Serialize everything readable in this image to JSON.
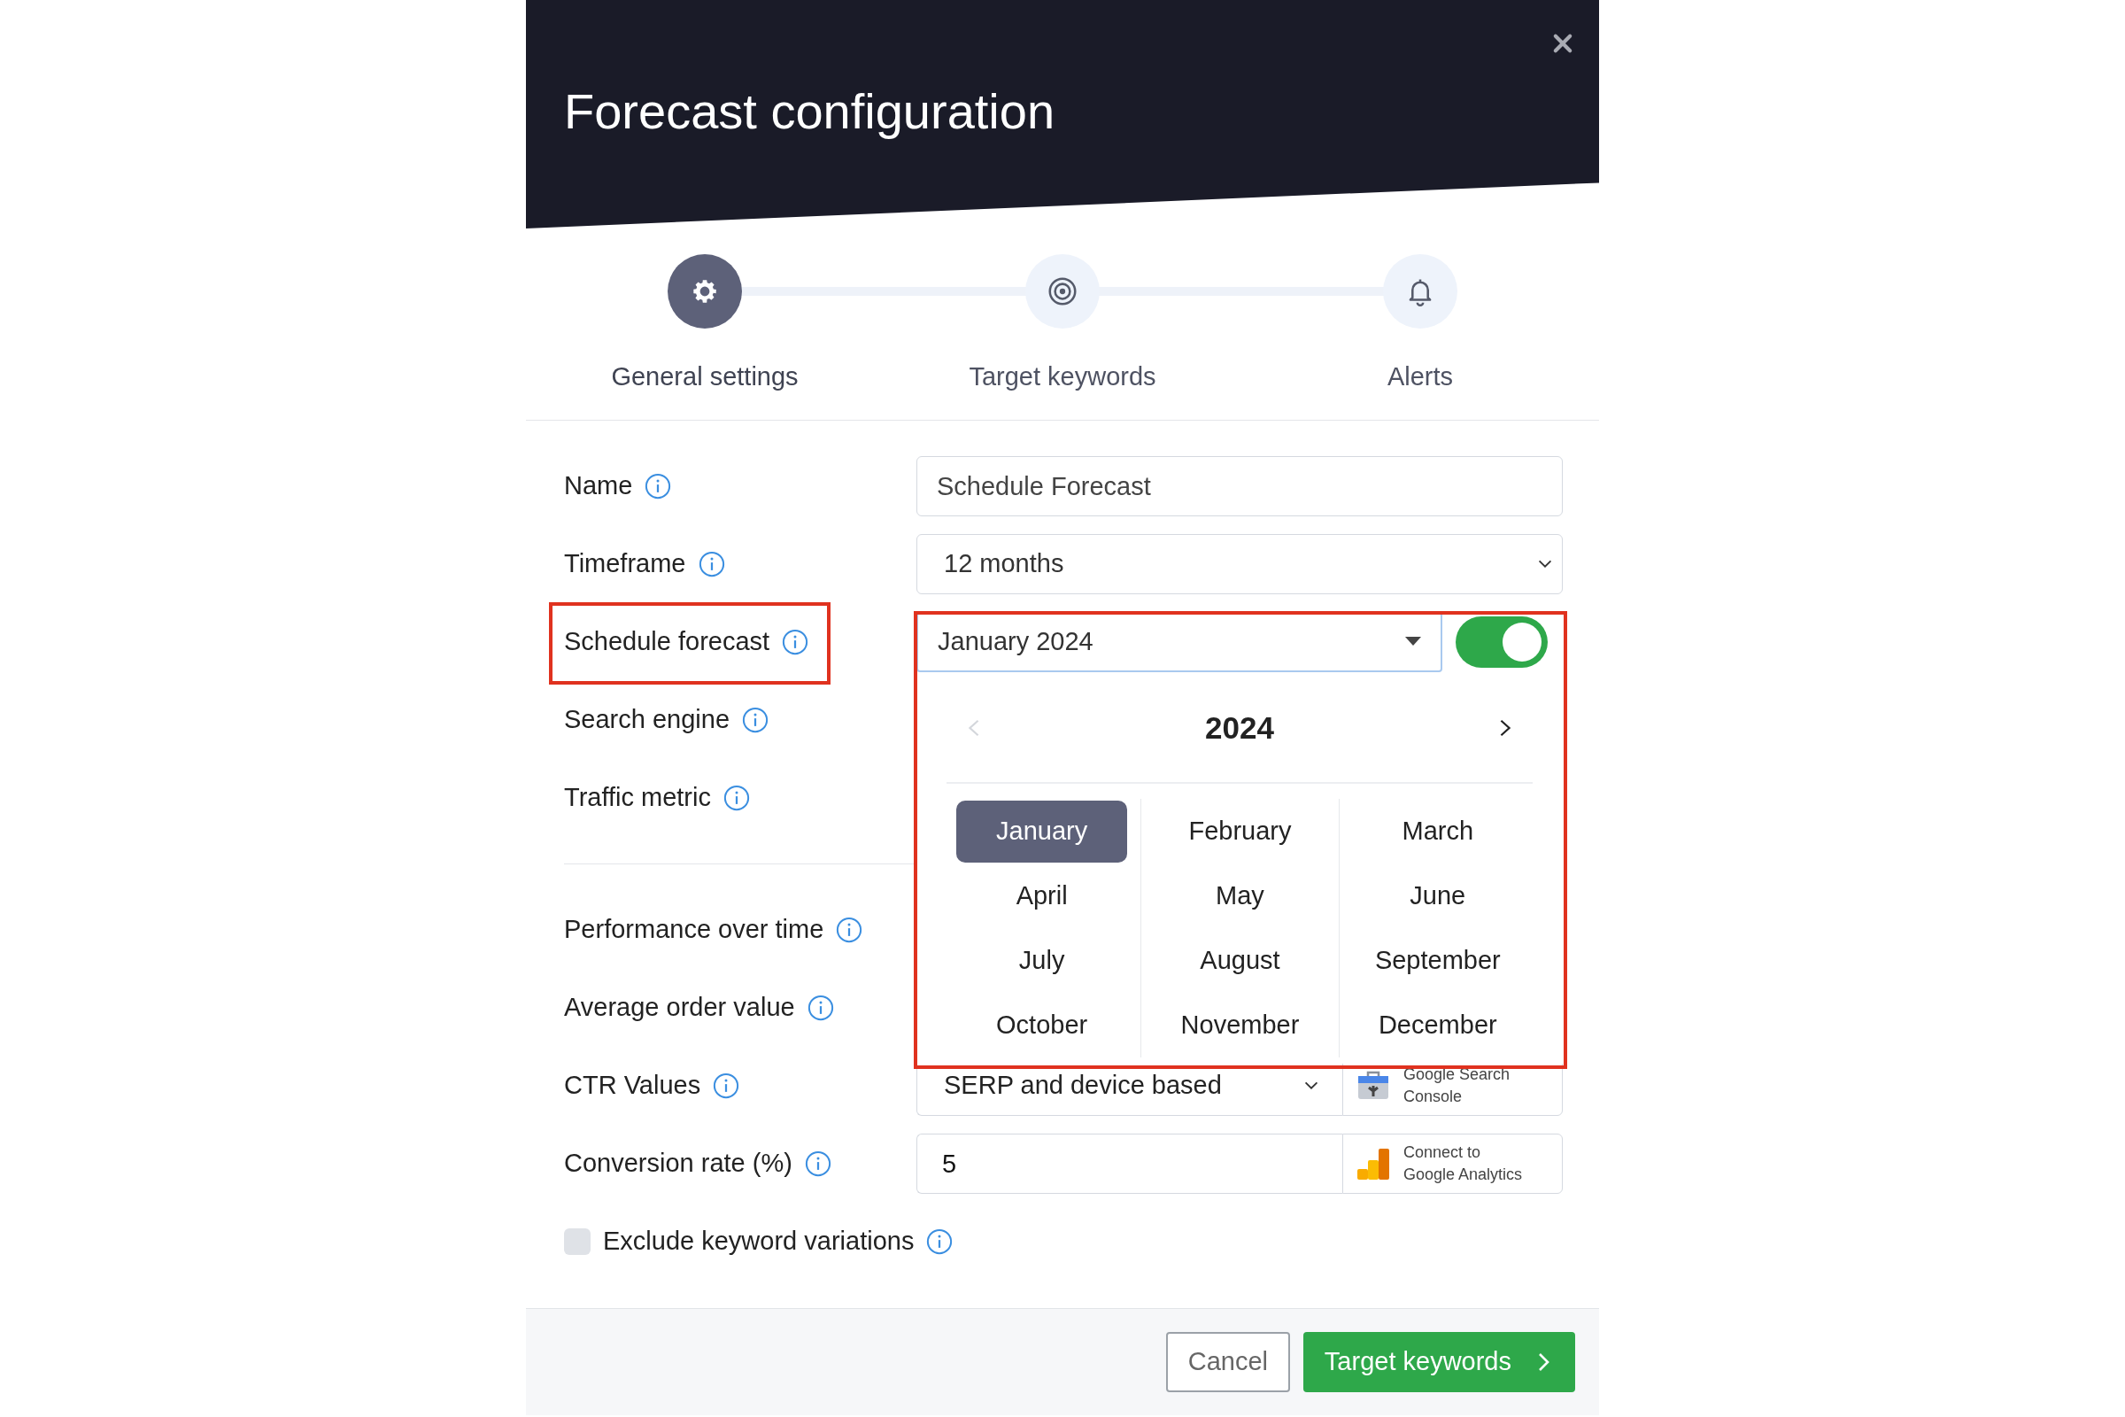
{
  "dialog": {
    "title": "Forecast configuration"
  },
  "steps": [
    {
      "label": "General settings",
      "selected": true
    },
    {
      "label": "Target keywords",
      "selected": false
    },
    {
      "label": "Alerts",
      "selected": false
    }
  ],
  "fields": [
    {
      "label": "Name",
      "kind": "text",
      "value": "Schedule Forecast"
    },
    {
      "label": "Timeframe",
      "kind": "select",
      "value": "12 months"
    },
    {
      "label": "Schedule forecast",
      "kind": "month",
      "value": "January 2024",
      "on": true,
      "highlighted": true
    },
    {
      "label": "Search engine",
      "kind": "covered"
    },
    {
      "label": "Traffic metric",
      "kind": "covered"
    }
  ],
  "revenue_fields": [
    {
      "label": "Performance over time",
      "kind": "covered"
    },
    {
      "label": "Average order value",
      "kind": "covered"
    },
    {
      "label": "CTR Values",
      "kind": "select_connect",
      "value": "SERP and device based",
      "connect": "Google Search Console"
    },
    {
      "label": "Conversion rate (%)",
      "kind": "text_connect",
      "value": "5",
      "connect": "Connect to Google Analytics"
    }
  ],
  "checkbox": {
    "label": "Exclude keyword variations",
    "checked": false
  },
  "month_picker": {
    "year": "2024",
    "prev_disabled": true,
    "highlighted": true,
    "months": [
      {
        "label": "January",
        "selected": true
      },
      {
        "label": "February",
        "selected": false
      },
      {
        "label": "March",
        "selected": false
      },
      {
        "label": "April",
        "selected": false
      },
      {
        "label": "May",
        "selected": false
      },
      {
        "label": "June",
        "selected": false
      },
      {
        "label": "July",
        "selected": false
      },
      {
        "label": "August",
        "selected": false
      },
      {
        "label": "September",
        "selected": false
      },
      {
        "label": "October",
        "selected": false
      },
      {
        "label": "November",
        "selected": false
      },
      {
        "label": "December",
        "selected": false
      }
    ]
  },
  "buttons": [
    {
      "label": "Cancel",
      "kind": "secondary"
    },
    {
      "label": "Target keywords",
      "kind": "primary"
    }
  ]
}
